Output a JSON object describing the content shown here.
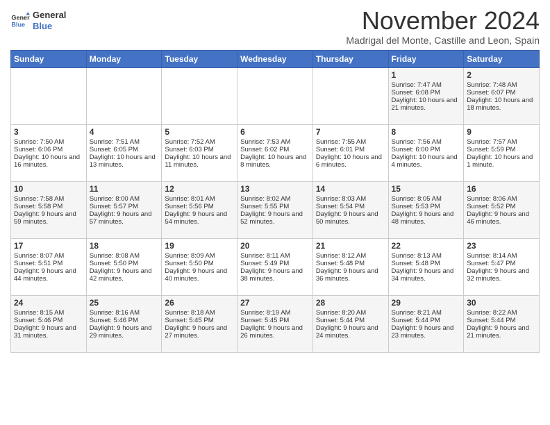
{
  "header": {
    "logo_line1": "General",
    "logo_line2": "Blue",
    "month": "November 2024",
    "location": "Madrigal del Monte, Castille and Leon, Spain"
  },
  "days_of_week": [
    "Sunday",
    "Monday",
    "Tuesday",
    "Wednesday",
    "Thursday",
    "Friday",
    "Saturday"
  ],
  "weeks": [
    [
      {
        "day": "",
        "info": ""
      },
      {
        "day": "",
        "info": ""
      },
      {
        "day": "",
        "info": ""
      },
      {
        "day": "",
        "info": ""
      },
      {
        "day": "",
        "info": ""
      },
      {
        "day": "1",
        "info": "Sunrise: 7:47 AM\nSunset: 6:08 PM\nDaylight: 10 hours and 21 minutes."
      },
      {
        "day": "2",
        "info": "Sunrise: 7:48 AM\nSunset: 6:07 PM\nDaylight: 10 hours and 18 minutes."
      }
    ],
    [
      {
        "day": "3",
        "info": "Sunrise: 7:50 AM\nSunset: 6:06 PM\nDaylight: 10 hours and 16 minutes."
      },
      {
        "day": "4",
        "info": "Sunrise: 7:51 AM\nSunset: 6:05 PM\nDaylight: 10 hours and 13 minutes."
      },
      {
        "day": "5",
        "info": "Sunrise: 7:52 AM\nSunset: 6:03 PM\nDaylight: 10 hours and 11 minutes."
      },
      {
        "day": "6",
        "info": "Sunrise: 7:53 AM\nSunset: 6:02 PM\nDaylight: 10 hours and 8 minutes."
      },
      {
        "day": "7",
        "info": "Sunrise: 7:55 AM\nSunset: 6:01 PM\nDaylight: 10 hours and 6 minutes."
      },
      {
        "day": "8",
        "info": "Sunrise: 7:56 AM\nSunset: 6:00 PM\nDaylight: 10 hours and 4 minutes."
      },
      {
        "day": "9",
        "info": "Sunrise: 7:57 AM\nSunset: 5:59 PM\nDaylight: 10 hours and 1 minute."
      }
    ],
    [
      {
        "day": "10",
        "info": "Sunrise: 7:58 AM\nSunset: 5:58 PM\nDaylight: 9 hours and 59 minutes."
      },
      {
        "day": "11",
        "info": "Sunrise: 8:00 AM\nSunset: 5:57 PM\nDaylight: 9 hours and 57 minutes."
      },
      {
        "day": "12",
        "info": "Sunrise: 8:01 AM\nSunset: 5:56 PM\nDaylight: 9 hours and 54 minutes."
      },
      {
        "day": "13",
        "info": "Sunrise: 8:02 AM\nSunset: 5:55 PM\nDaylight: 9 hours and 52 minutes."
      },
      {
        "day": "14",
        "info": "Sunrise: 8:03 AM\nSunset: 5:54 PM\nDaylight: 9 hours and 50 minutes."
      },
      {
        "day": "15",
        "info": "Sunrise: 8:05 AM\nSunset: 5:53 PM\nDaylight: 9 hours and 48 minutes."
      },
      {
        "day": "16",
        "info": "Sunrise: 8:06 AM\nSunset: 5:52 PM\nDaylight: 9 hours and 46 minutes."
      }
    ],
    [
      {
        "day": "17",
        "info": "Sunrise: 8:07 AM\nSunset: 5:51 PM\nDaylight: 9 hours and 44 minutes."
      },
      {
        "day": "18",
        "info": "Sunrise: 8:08 AM\nSunset: 5:50 PM\nDaylight: 9 hours and 42 minutes."
      },
      {
        "day": "19",
        "info": "Sunrise: 8:09 AM\nSunset: 5:50 PM\nDaylight: 9 hours and 40 minutes."
      },
      {
        "day": "20",
        "info": "Sunrise: 8:11 AM\nSunset: 5:49 PM\nDaylight: 9 hours and 38 minutes."
      },
      {
        "day": "21",
        "info": "Sunrise: 8:12 AM\nSunset: 5:48 PM\nDaylight: 9 hours and 36 minutes."
      },
      {
        "day": "22",
        "info": "Sunrise: 8:13 AM\nSunset: 5:48 PM\nDaylight: 9 hours and 34 minutes."
      },
      {
        "day": "23",
        "info": "Sunrise: 8:14 AM\nSunset: 5:47 PM\nDaylight: 9 hours and 32 minutes."
      }
    ],
    [
      {
        "day": "24",
        "info": "Sunrise: 8:15 AM\nSunset: 5:46 PM\nDaylight: 9 hours and 31 minutes."
      },
      {
        "day": "25",
        "info": "Sunrise: 8:16 AM\nSunset: 5:46 PM\nDaylight: 9 hours and 29 minutes."
      },
      {
        "day": "26",
        "info": "Sunrise: 8:18 AM\nSunset: 5:45 PM\nDaylight: 9 hours and 27 minutes."
      },
      {
        "day": "27",
        "info": "Sunrise: 8:19 AM\nSunset: 5:45 PM\nDaylight: 9 hours and 26 minutes."
      },
      {
        "day": "28",
        "info": "Sunrise: 8:20 AM\nSunset: 5:44 PM\nDaylight: 9 hours and 24 minutes."
      },
      {
        "day": "29",
        "info": "Sunrise: 8:21 AM\nSunset: 5:44 PM\nDaylight: 9 hours and 23 minutes."
      },
      {
        "day": "30",
        "info": "Sunrise: 8:22 AM\nSunset: 5:44 PM\nDaylight: 9 hours and 21 minutes."
      }
    ]
  ]
}
